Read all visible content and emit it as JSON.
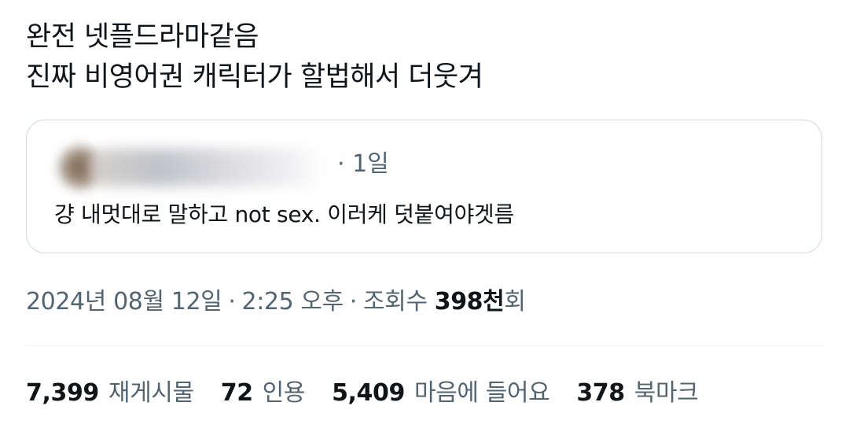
{
  "tweet": {
    "text_line_1": "완전 넷플드라마같음",
    "text_line_2": "진짜 비영어권 캐릭터가 할법해서 더웃겨"
  },
  "quoted_tweet": {
    "time": "· 1일",
    "text": "걍 내멋대로 말하고 not sex. 이러케 덧붙여야겟름"
  },
  "meta": {
    "date": "2024년 08월 12일",
    "separator": "·",
    "time": "2:25 오후",
    "views_label": "조회수",
    "views_count": "398천",
    "views_suffix": "회"
  },
  "stats": [
    {
      "value": "7,399",
      "label": "재게시물"
    },
    {
      "value": "72",
      "label": "인용"
    },
    {
      "value": "5,409",
      "label": "마음에 들어요"
    },
    {
      "value": "378",
      "label": "북마크"
    }
  ]
}
